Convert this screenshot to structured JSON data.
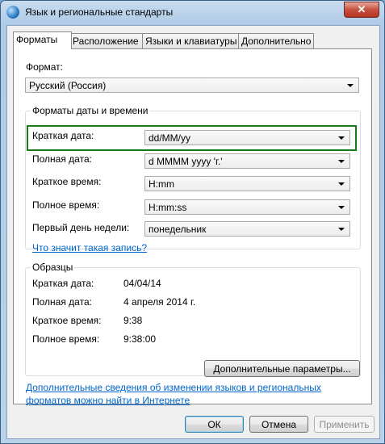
{
  "window": {
    "title": "Язык и региональные стандарты"
  },
  "tabs": [
    {
      "label": "Форматы"
    },
    {
      "label": "Расположение"
    },
    {
      "label": "Языки и клавиатуры"
    },
    {
      "label": "Дополнительно"
    }
  ],
  "format": {
    "label": "Формат:",
    "value": "Русский (Россия)"
  },
  "datetime_group": {
    "title": "Форматы даты и времени",
    "rows": [
      {
        "label": "Краткая дата:",
        "value": "dd/MM/yy"
      },
      {
        "label": "Полная дата:",
        "value": "d MMMM yyyy 'г.'"
      },
      {
        "label": "Краткое время:",
        "value": "H:mm"
      },
      {
        "label": "Полное время:",
        "value": "H:mm:ss"
      },
      {
        "label": "Первый день недели:",
        "value": "понедельник"
      }
    ],
    "help_link": "Что значит такая запись?"
  },
  "samples": {
    "title": "Образцы",
    "rows": [
      {
        "label": "Краткая дата:",
        "value": "04/04/14"
      },
      {
        "label": "Полная дата:",
        "value": "4 апреля 2014 г."
      },
      {
        "label": "Краткое время:",
        "value": "9:38"
      },
      {
        "label": "Полное время:",
        "value": "9:38:00"
      }
    ]
  },
  "advanced_button": "Дополнительные параметры...",
  "footer_link": "Дополнительные сведения об изменении языков и региональных форматов можно найти в Интернете",
  "buttons": {
    "ok": "ОК",
    "cancel": "Отмена",
    "apply": "Применить"
  },
  "colors": {
    "highlight": "#1a7a1a",
    "link": "#0066cc"
  }
}
